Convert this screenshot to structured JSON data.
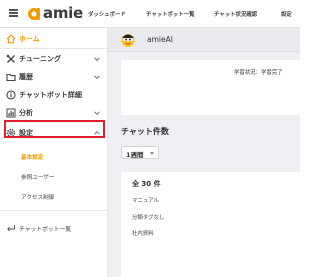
{
  "header": {
    "logo_text": "amie",
    "nav": [
      "ダッシュボード",
      "チャットボット一覧",
      "チャット状況確認",
      "設定"
    ]
  },
  "sidebar": {
    "items": [
      {
        "label": "ホーム",
        "icon": "home-icon",
        "active": true
      },
      {
        "label": "チューニング",
        "icon": "tools-icon"
      },
      {
        "label": "履歴",
        "icon": "folder-icon"
      },
      {
        "label": "チャットボット詳細",
        "icon": "info-icon"
      },
      {
        "label": "分析",
        "icon": "chart-icon"
      },
      {
        "label": "設定",
        "icon": "gear-icon"
      }
    ],
    "settings_sub": [
      "基本設定",
      "参照ユーザー",
      "アクセス制御"
    ],
    "back_label": "チャットボット一覧"
  },
  "bot": {
    "name": "amieAI"
  },
  "status": {
    "learning": "学習状況：学習完了"
  },
  "chat_count": {
    "heading": "チャット件数",
    "period": "1週間",
    "total": "全 30 件",
    "rows": [
      "マニュアル",
      "分類タグなし",
      "社内資料"
    ]
  },
  "colors": {
    "accent": "#f39800",
    "highlight": "#e0202a",
    "main_bg": "#eef0f4"
  }
}
